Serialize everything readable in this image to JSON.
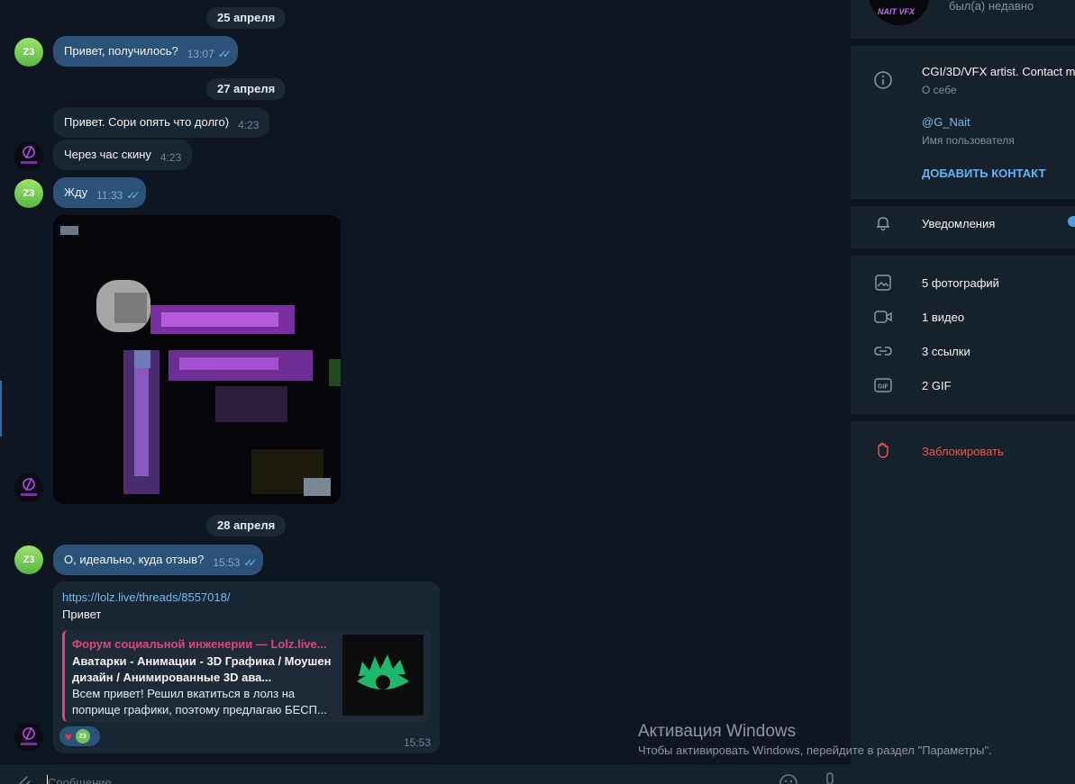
{
  "chat": {
    "dates": [
      "25 апреля",
      "27 апреля",
      "28 апреля"
    ],
    "messages": [
      {
        "text": "Привет, получилось?",
        "time": "13:07"
      },
      {
        "text": "Привет. Сори опять что долго)",
        "time": "4:23"
      },
      {
        "text": "Через час скину",
        "time": "4:23"
      },
      {
        "text": "Жду",
        "time": "11:33"
      },
      {
        "text": "О, идеально, куда отзыв?",
        "time": "15:53"
      }
    ],
    "avatar_initials": "Z3",
    "link_message": {
      "url": "https://lolz.live/threads/8557018/",
      "text": "Привет",
      "preview_site": "Форум социальной инженерии — Lolz.live...",
      "preview_title": "Аватарки - Анимации - 3D Графика / Моушен дизайн / Анимированные 3D ава...",
      "preview_desc": "Всем привет! Решил вкатиться в лолз на поприще графики, поэтому предлагаю БЕСП...",
      "time": "15:53",
      "reaction_avatar": "Z3"
    },
    "input_placeholder": "Сообщение"
  },
  "profile": {
    "avatar_label": "NAIT VFX",
    "status": "был(а) недавно",
    "bio": "CGI/3D/VFX artist. Contact m",
    "bio_label": "О себе",
    "username": "@G_Nait",
    "username_label": "Имя пользователя",
    "add_contact": "ДОБАВИТЬ КОНТАКТ",
    "notifications": "Уведомления",
    "media": {
      "photos": "5 фотографий",
      "videos": "1 видео",
      "links": "3 ссылки",
      "gifs": "2 GIF"
    },
    "block": "Заблокировать"
  },
  "watermark": {
    "title": "Активация Windows",
    "subtitle": "Чтобы активировать Windows, перейдите в раздел \"Параметры\"."
  },
  "colors": {
    "chat_bg": "#0e1621",
    "panel_bg": "#17212b",
    "outgoing_bubble": "#2b5278",
    "incoming_bubble": "#182533",
    "accent": "#5eb5f7",
    "danger": "#e8584c",
    "preview_accent": "#e0447a"
  }
}
